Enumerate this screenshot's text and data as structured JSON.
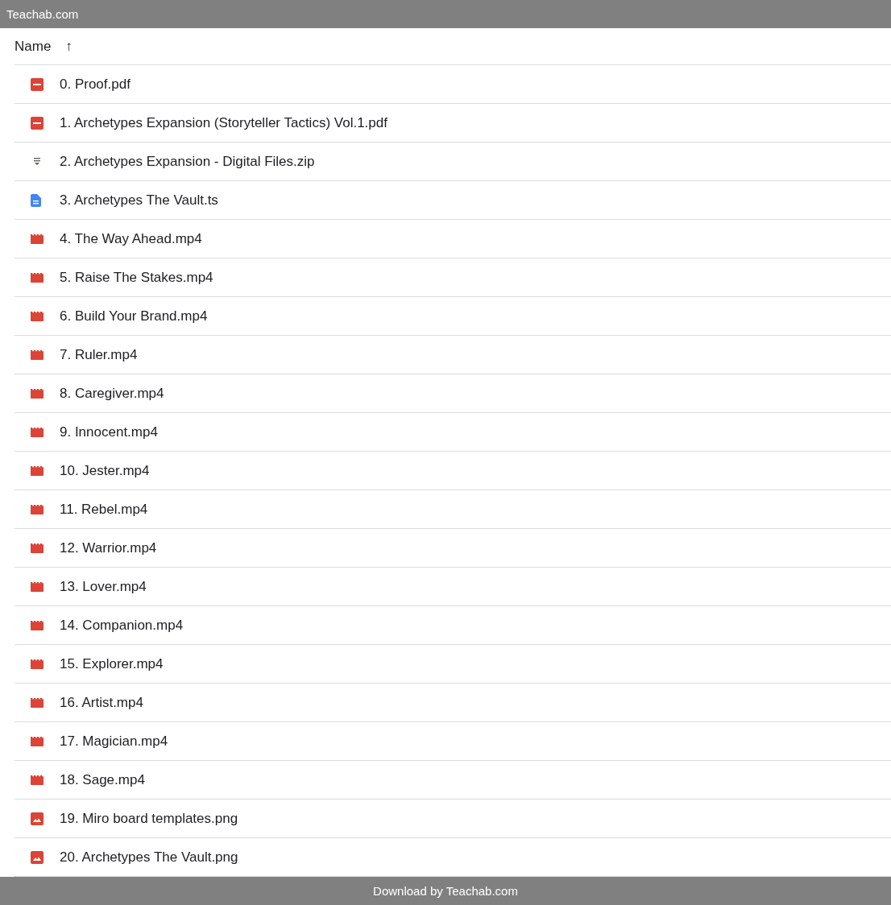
{
  "top_bar": {
    "title": "Teachab.com"
  },
  "table": {
    "columns": [
      {
        "label": "Name",
        "sort_icon": "↑"
      }
    ],
    "rows": [
      {
        "kind": "pdf",
        "name": "0. Proof.pdf"
      },
      {
        "kind": "pdf",
        "name": "1. Archetypes Expansion (Storyteller Tactics) Vol.1.pdf"
      },
      {
        "kind": "archive",
        "name": "2. Archetypes Expansion - Digital Files.zip"
      },
      {
        "kind": "doc",
        "name": "3. Archetypes The Vault.ts"
      },
      {
        "kind": "video",
        "name": "4. The Way Ahead.mp4"
      },
      {
        "kind": "video",
        "name": "5. Raise The Stakes.mp4"
      },
      {
        "kind": "video",
        "name": "6. Build Your Brand.mp4"
      },
      {
        "kind": "video",
        "name": "7. Ruler.mp4"
      },
      {
        "kind": "video",
        "name": "8. Caregiver.mp4"
      },
      {
        "kind": "video",
        "name": "9. Innocent.mp4"
      },
      {
        "kind": "video",
        "name": "10. Jester.mp4"
      },
      {
        "kind": "video",
        "name": "11. Rebel.mp4"
      },
      {
        "kind": "video",
        "name": "12. Warrior.mp4"
      },
      {
        "kind": "video",
        "name": "13. Lover.mp4"
      },
      {
        "kind": "video",
        "name": "14. Companion.mp4"
      },
      {
        "kind": "video",
        "name": "15. Explorer.mp4"
      },
      {
        "kind": "video",
        "name": "16. Artist.mp4"
      },
      {
        "kind": "video",
        "name": "17. Magician.mp4"
      },
      {
        "kind": "video",
        "name": "18. Sage.mp4"
      },
      {
        "kind": "image",
        "name": "19. Miro board templates.png"
      },
      {
        "kind": "image",
        "name": "20. Archetypes The Vault.png"
      }
    ]
  },
  "bottom_bar": {
    "text": "Download by Teachab.com"
  }
}
